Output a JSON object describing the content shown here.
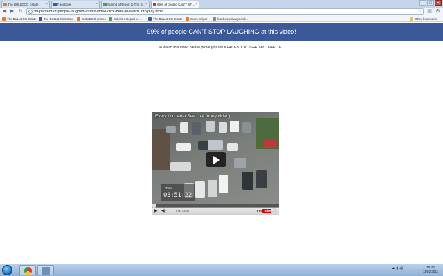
{
  "browser": {
    "tabs": [
      {
        "label": "The BULLDOG Estate",
        "favicon_color": "#e07a2a",
        "active": false
      },
      {
        "label": "Facebook",
        "favicon_color": "#3b5998",
        "active": false
      },
      {
        "label": "Submit a Report to The B…",
        "favicon_color": "#4aa05a",
        "active": false
      },
      {
        "label": "99% of people CAN'T ST…",
        "favicon_color": "#c33",
        "active": true
      }
    ],
    "window_controls": {
      "minimize": "–",
      "maximize": "□",
      "close": "✕"
    },
    "address": "99-percent-of-people-laughed-at-this-video-click-here-to-watch.info/play.html",
    "bookmarks": [
      {
        "label": "The BULLDOG Estate",
        "favicon_color": "#e07a2a"
      },
      {
        "label": "The BULLDOG Estate",
        "favicon_color": "#3b5998"
      },
      {
        "label": "BULLDOG entries",
        "favicon_color": "#e07a2a"
      },
      {
        "label": "Submit a Report to ...",
        "favicon_color": "#4aa05a"
      },
      {
        "label": "The BULLDOG Estate",
        "favicon_color": "#3b5998"
      },
      {
        "label": "Scam Sniper",
        "favicon_color": "#e07a2a"
      },
      {
        "label": "facebookprivacysend...",
        "favicon_color": "#888"
      }
    ],
    "other_bookmarks": "Other bookmarks"
  },
  "page": {
    "banner": "99% of people CAN'T STOP LAUGHING at this video!",
    "banner_color": "#3b5998",
    "prompt": "To watch this video please prove you are a FACEBOOK USER and OVER 16 ..."
  },
  "video": {
    "title": "Every Girl Must See... (A funny video)",
    "overlay_label": "Time",
    "overlay_time": "03:51:22",
    "timecode": "0:00 / 3:46",
    "brand_you": "You",
    "brand_tube": "Tube"
  },
  "taskbar": {
    "clock_time": "15:43",
    "clock_date": "11/02/2011"
  }
}
